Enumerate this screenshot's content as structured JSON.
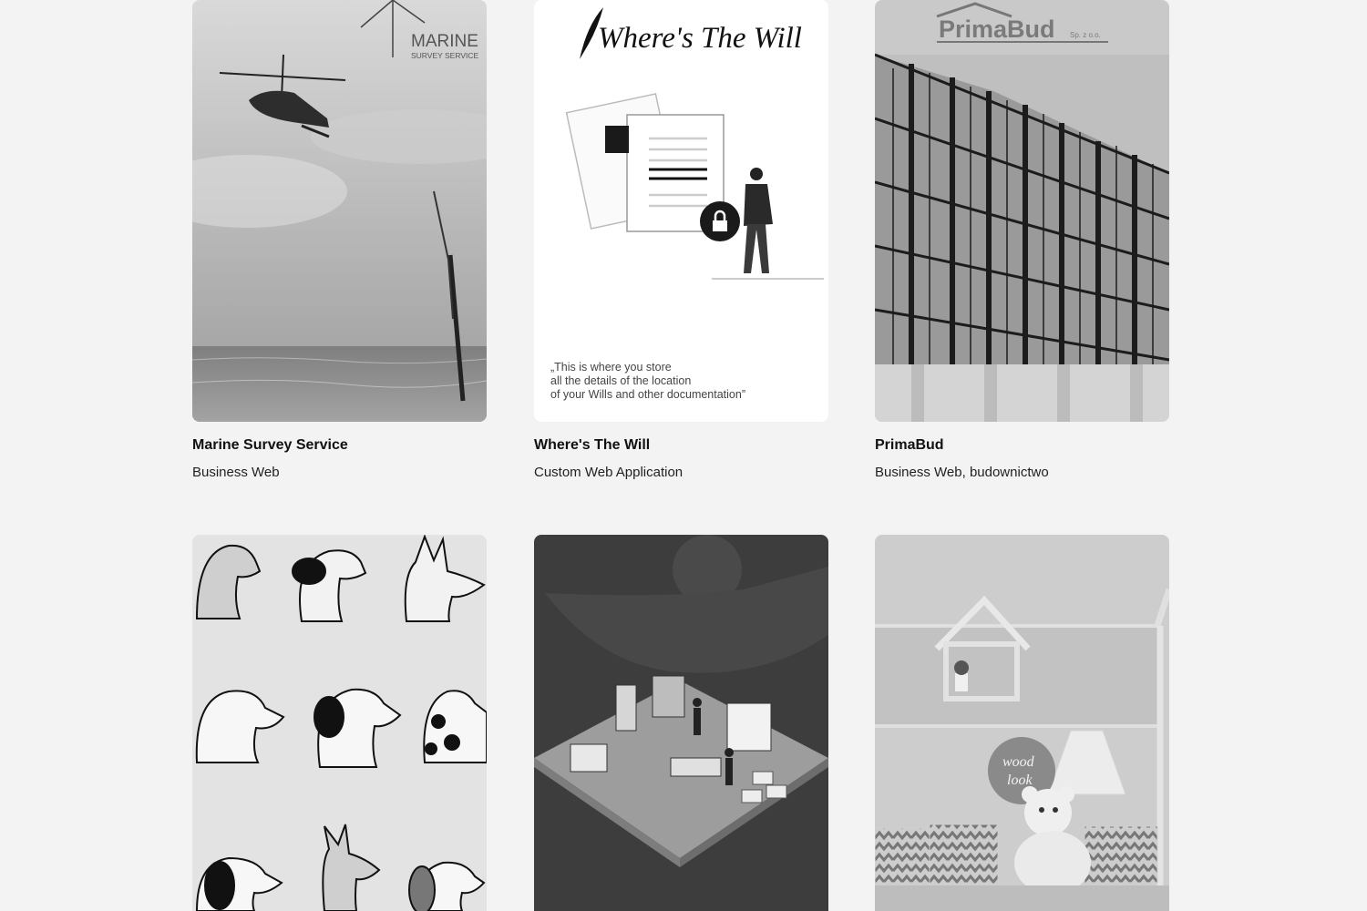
{
  "portfolio": {
    "items": [
      {
        "title": "Marine Survey Service",
        "category": "Business Web",
        "logo_line1": "MARINE",
        "logo_line2": "SURVEY SERVICE"
      },
      {
        "title": "Where's The Will",
        "category": "Custom Web Application",
        "logo_text": "Where's The Will",
        "quote_line1": "„This is where you store",
        "quote_line2": "all the details of the location",
        "quote_line3": "of your Wills and other documentation”"
      },
      {
        "title": "PrimaBud",
        "category": "Business Web, budownictwo",
        "logo_text": "PrimaBud",
        "logo_suffix": "Sp. z o.o."
      },
      {
        "title": "",
        "category": ""
      },
      {
        "title": "",
        "category": ""
      },
      {
        "title": "",
        "category": "",
        "logo_line1": "wood",
        "logo_line2": "look"
      }
    ]
  }
}
